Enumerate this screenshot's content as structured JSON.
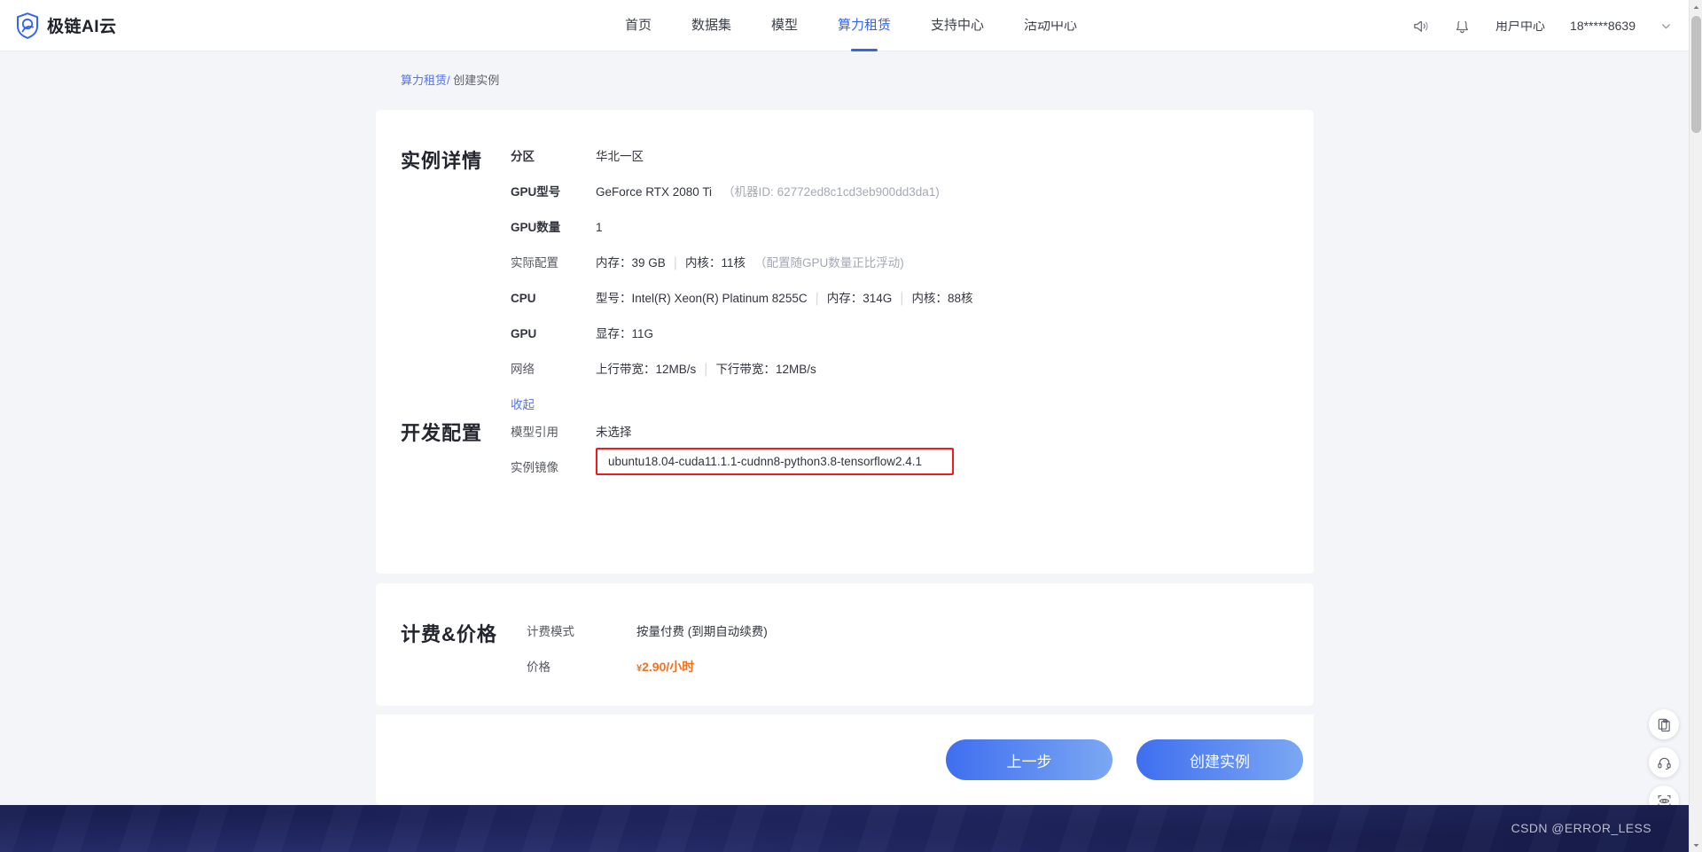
{
  "brand": {
    "name": "极链AI云",
    "logo_icon": "shield-logo-icon",
    "accent": "#3563f5"
  },
  "nav": {
    "links": [
      {
        "label": "首页",
        "active": false
      },
      {
        "label": "数据集",
        "active": false
      },
      {
        "label": "模型",
        "active": false
      },
      {
        "label": "算力租赁",
        "active": true
      },
      {
        "label": "支持中心",
        "active": false
      },
      {
        "label": "活动中心",
        "active": false
      }
    ],
    "right": {
      "announce_icon": "speaker-icon",
      "notification_icon": "bell-icon",
      "user_center": "用户中心",
      "phone": "18*****8639",
      "caret_icon": "chevron-down-icon"
    }
  },
  "breadcrumb": {
    "parent": "算力租赁",
    "separator": "/",
    "current": "创建实例"
  },
  "instance_detail": {
    "title": "实例详情",
    "rows": [
      {
        "label": "分区",
        "value": "华北一区"
      },
      {
        "label": "GPU型号",
        "value": "GeForce RTX 2080 Ti",
        "note": "（机器ID: 62772ed8c1cd3eb900dd3da1)"
      },
      {
        "label": "GPU数量",
        "value": "1"
      },
      {
        "label": "实际配置",
        "k1": "内存：",
        "v1": "39 GB",
        "k2": "内核：",
        "v2": "11核",
        "note": "（配置随GPU数量正比浮动)"
      },
      {
        "label": "CPU",
        "k1": "型号：",
        "v1": "Intel(R) Xeon(R) Platinum 8255C",
        "k2": "内存：",
        "v2": "314G",
        "k3": "内核：",
        "v3": "88核"
      },
      {
        "label": "GPU",
        "k1": "显存：",
        "v1": "11G"
      },
      {
        "label": "网络",
        "k1": "上行带宽：",
        "v1": "12MB/s",
        "k2": "下行带宽：",
        "v2": "12MB/s"
      }
    ],
    "collapse_label": "收起"
  },
  "dev_config": {
    "title": "开发配置",
    "model_ref_label": "模型引用",
    "model_ref_value": "未选择",
    "image_label": "实例镜像",
    "image_value": "ubuntu18.04-cuda11.1.1-cudnn8-python3.8-tensorflow2.4.1",
    "image_highlight_color": "#ee1c1c"
  },
  "billing": {
    "title": "计费&价格",
    "mode_label": "计费模式",
    "mode_value": "按量付费 (到期自动续费)",
    "price_label": "价格",
    "price_currency": "¥",
    "price_value": "2.90/小时",
    "price_color": "#f4711f"
  },
  "actions": {
    "prev_label": "上一步",
    "create_label": "创建实例"
  },
  "float_tools": [
    {
      "icon": "copy-icon",
      "name": "copy"
    },
    {
      "icon": "headset-support-icon",
      "name": "support"
    },
    {
      "icon": "eye-scan-icon",
      "name": "preview"
    }
  ],
  "footer": {
    "watermark": "CSDN @ERROR_LESS"
  }
}
